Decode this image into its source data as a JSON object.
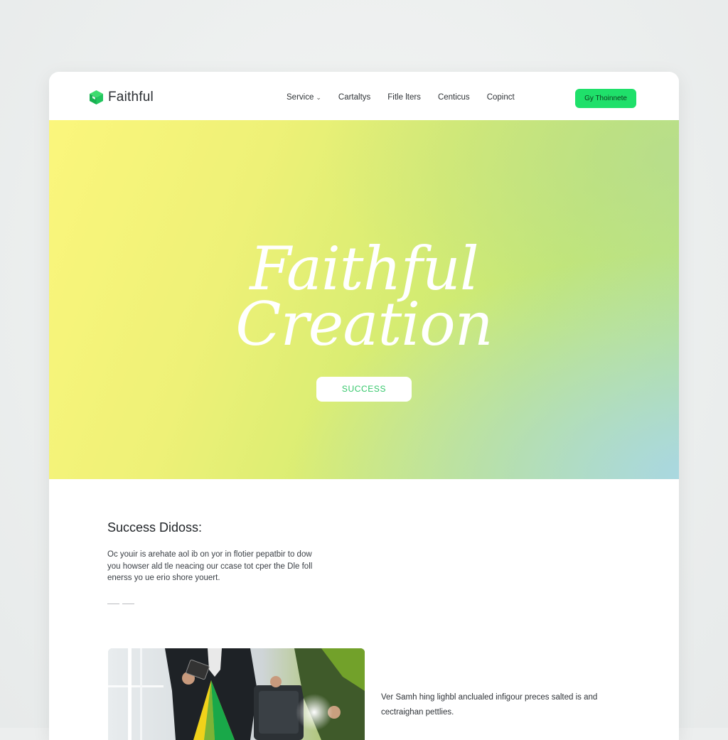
{
  "header": {
    "logo_text": "Faithful",
    "nav": [
      {
        "label": "Service",
        "has_dropdown": true
      },
      {
        "label": "Cartaltys",
        "has_dropdown": false
      },
      {
        "label": "Fitle lters",
        "has_dropdown": false
      },
      {
        "label": "Centicus",
        "has_dropdown": false
      },
      {
        "label": "Copinct",
        "has_dropdown": false
      }
    ],
    "cta_label": "Gy Thoinnete"
  },
  "hero": {
    "title_line1": "Faithful",
    "title_line2": "Creation",
    "button_label": "SUCCESS"
  },
  "content": {
    "section_title": "Success Didoss:",
    "section_body": "Oc youir is arehate aol ib on yor in flotier pepatbir to dow you howser ald tle neacing our ccase tot cper the Dle foll enerss yo ue erio shore youert.",
    "caption": "Ver Samh hing lighbl anclualed infigour preces salted is and cectraighan pettlies."
  },
  "icons": {
    "logo": "cube-logo-icon",
    "dropdown": "chevron-down-icon"
  },
  "colors": {
    "accent": "#1fe06a",
    "logo_green": "#22c55e",
    "hero_button_text": "#33c76a"
  }
}
